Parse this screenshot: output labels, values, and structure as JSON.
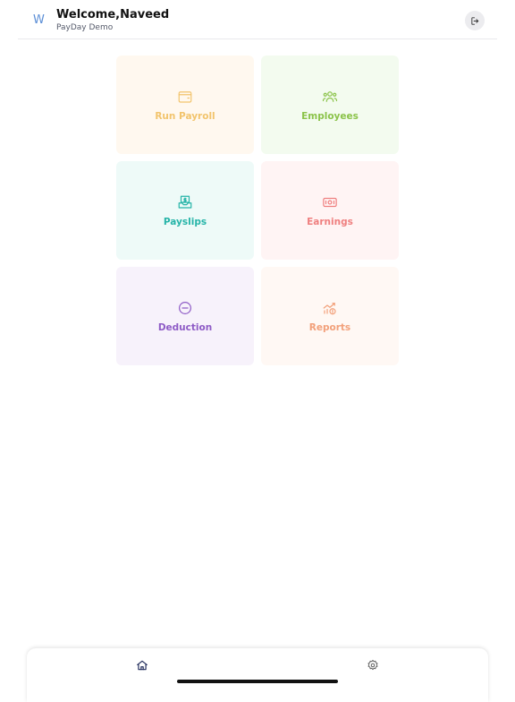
{
  "header": {
    "avatar_letter": "W",
    "welcome": "Welcome,Naveed",
    "subtitle": "PayDay Demo"
  },
  "cards": [
    {
      "label": "Run Payroll",
      "icon": "wallet-icon",
      "color": "#f2c46d",
      "bg": "#fff8ef"
    },
    {
      "label": "Employees",
      "icon": "users-icon",
      "color": "#8bc34a",
      "bg": "#f3fbef"
    },
    {
      "label": "Payslips",
      "icon": "payslip-icon",
      "color": "#26b4a8",
      "bg": "#eefaf8"
    },
    {
      "label": "Earnings",
      "icon": "cash-icon",
      "color": "#ef7f7f",
      "bg": "#fff4f4"
    },
    {
      "label": "Deduction",
      "icon": "minus-circle-icon",
      "color": "#8e5bc6",
      "bg": "#f7f2fb"
    },
    {
      "label": "Reports",
      "icon": "chart-icon",
      "color": "#f2a07a",
      "bg": "#fff8f4"
    }
  ],
  "tabbar": {
    "items": [
      {
        "icon": "home-icon",
        "active": true
      },
      {
        "icon": "gear-icon",
        "active": false
      }
    ]
  }
}
